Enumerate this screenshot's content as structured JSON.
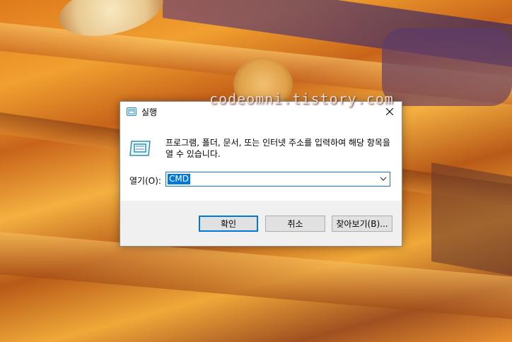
{
  "desktop": {
    "watermark": "codeomni.tistory.com"
  },
  "dialog": {
    "title": "실행",
    "description": "프로그램, 폴더, 문서, 또는 인터넷 주소를 입력하여 해당 항목을 열 수 있습니다.",
    "open_label": "열기(O):",
    "input_value": "CMD",
    "ok_label": "확인",
    "cancel_label": "취소",
    "browse_label": "찾아보기(B)..."
  },
  "colors": {
    "accent": "#0078d7",
    "footer_bg": "#f0f0f0",
    "button_bg": "#e1e1e1"
  },
  "icons": {
    "title": "run-icon",
    "body": "run-icon",
    "close": "close-icon",
    "dropdown": "chevron-down-icon"
  }
}
